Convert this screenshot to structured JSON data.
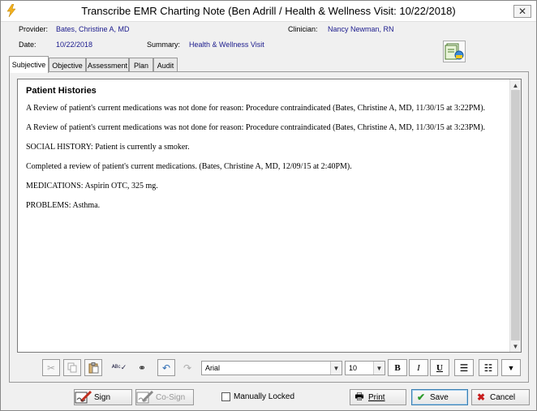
{
  "window": {
    "title": "Transcribe EMR Charting Note (Ben Adrill / Health & Wellness Visit: 10/22/2018)"
  },
  "header": {
    "provider_label": "Provider:",
    "provider_value": "Bates, Christine A, MD",
    "clinician_label": "Clinician:",
    "clinician_value": "Nancy Newman, RN",
    "date_label": "Date:",
    "date_value": "10/22/2018",
    "summary_label": "Summary:",
    "summary_value": "Health & Wellness Visit"
  },
  "tabs": [
    {
      "label": "Subjective",
      "active": true
    },
    {
      "label": "Objective"
    },
    {
      "label": "Assessment"
    },
    {
      "label": "Plan"
    },
    {
      "label": "Audit"
    }
  ],
  "editor": {
    "section_title": "Patient Histories",
    "paragraphs": [
      "A Review of patient's current medications was not done for reason: Procedure contraindicated (Bates, Christine A, MD, 11/30/15 at 3:22PM).",
      "A Review of patient's current medications was not done for reason: Procedure contraindicated (Bates, Christine A, MD, 11/30/15 at 3:23PM).",
      "SOCIAL HISTORY: Patient is currently a smoker.",
      "Completed a review of patient's current medications. (Bates, Christine A, MD, 12/09/15 at  2:40PM).",
      "MEDICATIONS: Aspirin OTC, 325 mg.",
      "PROBLEMS: Asthma."
    ]
  },
  "toolbar": {
    "font_family": "Arial",
    "font_size": "10",
    "bold": "B",
    "italic": "I",
    "underline": "U"
  },
  "footer": {
    "sign_label": "Sign",
    "cosign_label": "Co-Sign",
    "manually_locked_label": "Manually Locked",
    "print_label": "Print",
    "save_label": "Save",
    "cancel_label": "Cancel"
  }
}
